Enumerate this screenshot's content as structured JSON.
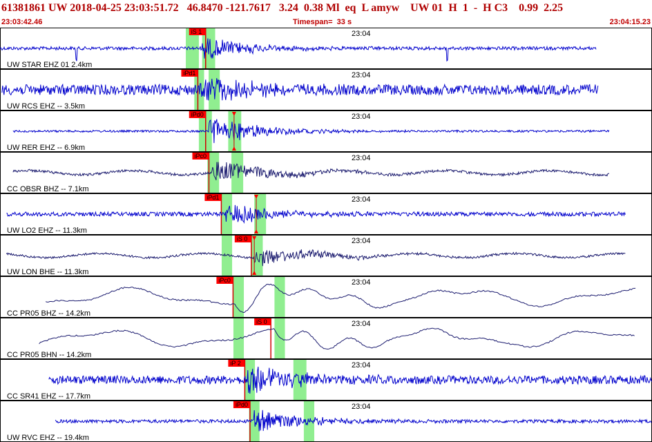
{
  "window": {
    "title": "61381861 UW 2018-04-25 23:03:51.72   46.8470 -121.7617   3.24  0.38 Ml  eq  L amyw    UW 01  H  1  -  H C3    0.99  2.25",
    "start_time": "23:03:42.46",
    "timespan": "Timespan=  33 s",
    "end_time": "23:04:15.23"
  },
  "colors": {
    "header_text": "#b00000",
    "pick_label_bg": "#ff0000",
    "pick_window": "#90ee90",
    "pick_line": "#d00000",
    "trace_broadband": "#1a1a6e",
    "trace_short_period": "#0000cc",
    "panel_border": "#000000"
  },
  "channels": [
    {
      "label": "UW STAR EHZ 01 2.4km",
      "time_label": "23:04",
      "picks": [
        {
          "label": "iS 1",
          "at": 0.29
        }
      ],
      "green_windows": [
        [
          0.285,
          0.305
        ],
        [
          0.31,
          0.33
        ]
      ],
      "markers": [],
      "trace": {
        "start": 0.0,
        "end": 0.915,
        "kind": "sp",
        "onset": 0.31,
        "amp": 0.55,
        "noise": 0.08,
        "spikes": [
          0.117,
          0.686
        ]
      }
    },
    {
      "label": "UW RCS EHZ -- 3.5km",
      "time_label": "23:04",
      "picks": [
        {
          "label": "iPd1",
          "at": 0.278
        }
      ],
      "green_windows": [
        [
          0.298,
          0.313
        ],
        [
          0.32,
          0.337
        ]
      ],
      "markers": [],
      "trace": {
        "start": 0.003,
        "end": 0.918,
        "kind": "sp",
        "onset": 0.305,
        "amp": 0.7,
        "noise": 0.25,
        "spikes": []
      }
    },
    {
      "label": "UW RER EHZ -- 6.9km",
      "time_label": "23:04",
      "picks": [
        {
          "label": "iPd0",
          "at": 0.29
        }
      ],
      "green_windows": [
        [
          0.305,
          0.325
        ],
        [
          0.35,
          0.37
        ]
      ],
      "markers": [
        0.359
      ],
      "trace": {
        "start": 0.02,
        "end": 0.935,
        "kind": "sp",
        "onset": 0.32,
        "amp": 0.75,
        "noise": 0.05,
        "spikes": []
      }
    },
    {
      "label": "CC OBSR BHZ -- 7.1km",
      "time_label": "23:04",
      "picks": [
        {
          "label": "iPc0",
          "at": 0.295
        }
      ],
      "green_windows": [
        [
          0.318,
          0.336
        ],
        [
          0.355,
          0.373
        ]
      ],
      "markers": [],
      "trace": {
        "start": 0.02,
        "end": 0.935,
        "kind": "bb",
        "onset": 0.325,
        "amp": 0.55,
        "noise": 0.06,
        "spikes": []
      }
    },
    {
      "label": "UW LO2 EHZ -- 11.3km",
      "time_label": "23:04",
      "picks": [
        {
          "label": "iPd1",
          "at": 0.314
        }
      ],
      "green_windows": [
        [
          0.34,
          0.356
        ],
        [
          0.39,
          0.408
        ]
      ],
      "markers": [
        0.393
      ],
      "trace": {
        "start": 0.01,
        "end": 0.96,
        "kind": "sp",
        "onset": 0.345,
        "amp": 0.55,
        "noise": 0.1,
        "spikes": []
      }
    },
    {
      "label": "UW LON BHE -- 11.3km",
      "time_label": "23:04",
      "picks": [
        {
          "label": "iS 0",
          "at": 0.36
        }
      ],
      "green_windows": [
        [
          0.34,
          0.356
        ],
        [
          0.385,
          0.403
        ]
      ],
      "markers": [
        0.39
      ],
      "trace": {
        "start": 0.01,
        "end": 0.96,
        "kind": "bb",
        "onset": 0.39,
        "amp": 0.45,
        "noise": 0.05,
        "spikes": []
      }
    },
    {
      "label": "CC PR05 BHZ -- 14.2km",
      "time_label": "23:04",
      "picks": [
        {
          "label": "iPc0",
          "at": 0.332
        }
      ],
      "green_windows": [
        [
          0.358,
          0.374
        ],
        [
          0.421,
          0.437
        ]
      ],
      "markers": [],
      "trace": {
        "start": 0.07,
        "end": 0.975,
        "kind": "lp",
        "onset": 0.36,
        "amp": 0.3,
        "noise": 0.02,
        "spikes": []
      }
    },
    {
      "label": "CC PR05 BHN -- 14.2km",
      "time_label": "23:04",
      "picks": [
        {
          "label": "iS 0",
          "at": 0.39
        }
      ],
      "green_windows": [
        [
          0.358,
          0.374
        ],
        [
          0.421,
          0.437
        ]
      ],
      "markers": [],
      "trace": {
        "start": 0.06,
        "end": 0.975,
        "kind": "lp",
        "onset": 0.42,
        "amp": 0.35,
        "noise": 0.02,
        "spikes": []
      }
    },
    {
      "label": "CC SR41 EHZ -- 17.7km",
      "time_label": "23:04",
      "picks": [
        {
          "label": "iP 2",
          "at": 0.35
        }
      ],
      "green_windows": [
        [
          0.375,
          0.391
        ],
        [
          0.45,
          0.47
        ]
      ],
      "markers": [],
      "trace": {
        "start": 0.075,
        "end": 1.0,
        "kind": "sp",
        "onset": 0.38,
        "amp": 0.75,
        "noise": 0.2,
        "spikes": []
      }
    },
    {
      "label": "UW RVC EHZ -- 19.4km",
      "time_label": "23:04",
      "picks": [
        {
          "label": "iPd0",
          "at": 0.358
        }
      ],
      "green_windows": [
        [
          0.382,
          0.398
        ],
        [
          0.466,
          0.482
        ]
      ],
      "markers": [],
      "trace": {
        "start": 0.085,
        "end": 1.0,
        "kind": "sp",
        "onset": 0.39,
        "amp": 0.6,
        "noise": 0.08,
        "spikes": []
      }
    }
  ]
}
